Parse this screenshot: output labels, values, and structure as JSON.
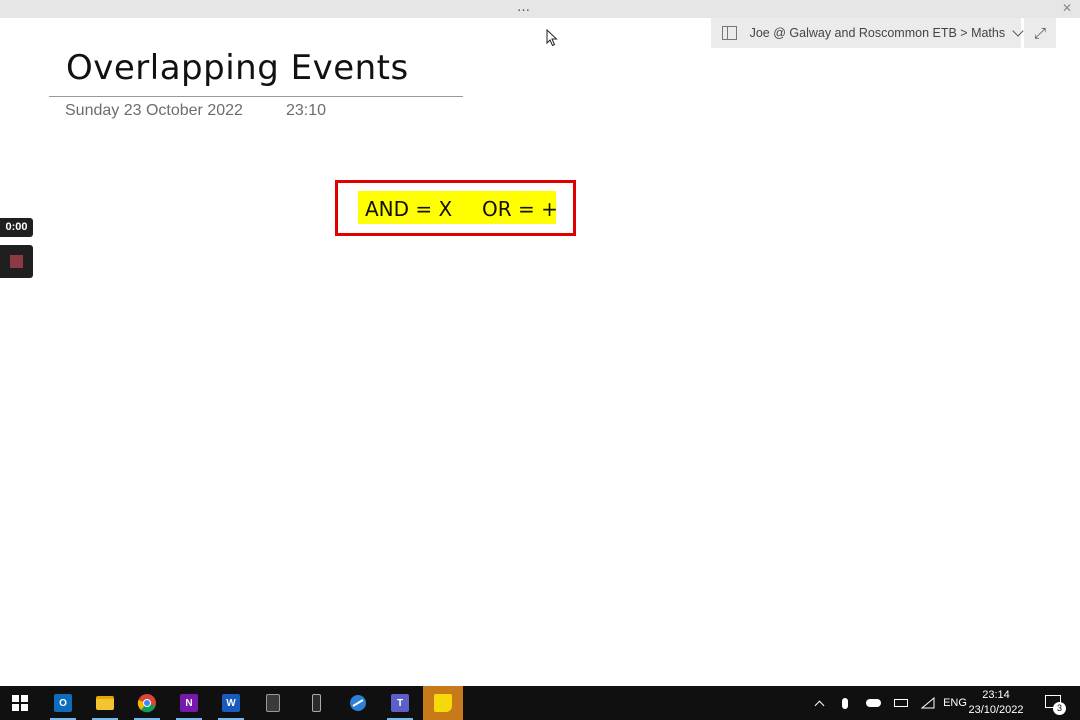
{
  "window": {
    "drag_handle": "…",
    "close_glyph": "✕"
  },
  "breadcrumb": {
    "text": "Joe @ Galway and Roscommon ETB > Maths",
    "expand_glyph": "⤢"
  },
  "page": {
    "title": "Overlapping Events",
    "date": "Sunday 23 October 2022",
    "time": "23:10"
  },
  "note": {
    "and_text": "AND = X",
    "or_text": "OR = +",
    "highlight_color": "#ffff00",
    "border_color": "#e00000"
  },
  "recorder": {
    "elapsed": "0:00"
  },
  "taskbar": {
    "apps": [
      {
        "name": "outlook",
        "label": "O"
      },
      {
        "name": "file-explorer",
        "label": ""
      },
      {
        "name": "chrome",
        "label": ""
      },
      {
        "name": "onenote",
        "label": "N"
      },
      {
        "name": "word",
        "label": "W"
      },
      {
        "name": "calculator",
        "label": ""
      },
      {
        "name": "phone",
        "label": ""
      },
      {
        "name": "remote-desktop",
        "label": ""
      },
      {
        "name": "teams",
        "label": "T"
      },
      {
        "name": "sticky-notes",
        "label": ""
      }
    ],
    "language": "ENG",
    "clock_time": "23:14",
    "clock_date": "23/10/2022",
    "notification_count": "3"
  }
}
